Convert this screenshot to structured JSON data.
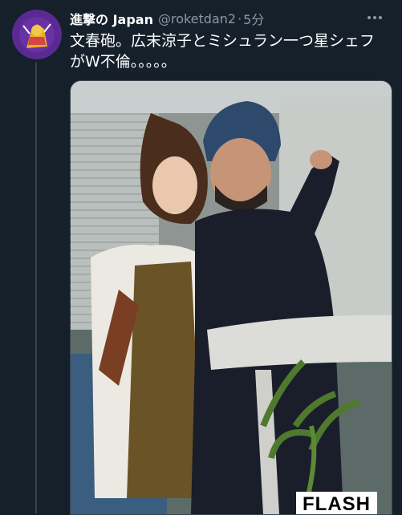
{
  "tweet": {
    "display_name": "進撃の Japan",
    "handle": "@roketdan2",
    "separator": "·",
    "time": "5分",
    "more_icon": "more-icon",
    "text": "文春砲。広末涼子とミシュラン一つ星シェフがW不倫。。。。。",
    "media": {
      "watermark": "FLASH"
    }
  },
  "colors": {
    "background": "#15202b",
    "secondary_text": "#8b98a5",
    "border": "#38444d"
  }
}
